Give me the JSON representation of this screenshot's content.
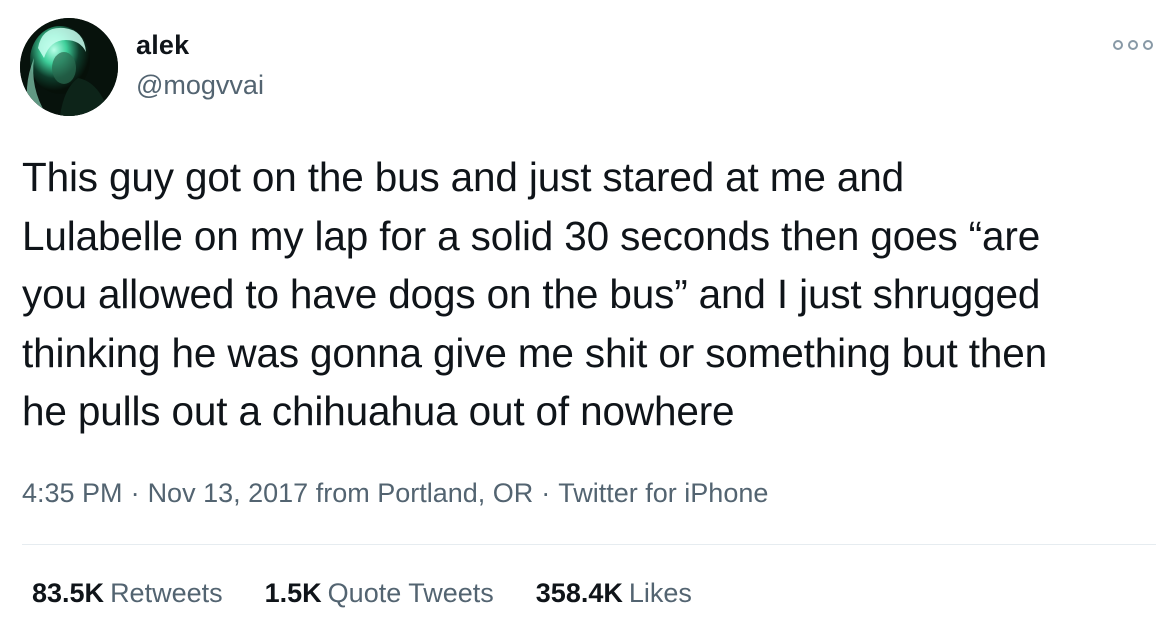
{
  "user": {
    "display_name": "alek",
    "handle": "@mogvvai"
  },
  "tweet": {
    "text": "This guy got on the bus and just stared at me and\nLulabelle on my lap for a solid 30 seconds then goes “are\nyou allowed to have dogs on the bus” and I just shrugged\nthinking he was gonna give me shit or something but then\nhe pulls out a chihuahua out of nowhere",
    "time": "4:35 PM",
    "date": "Nov 13, 2017",
    "location": "from Portland, OR",
    "separator": "·",
    "client": "Twitter for iPhone"
  },
  "stats": {
    "retweets_count": "83.5K",
    "retweets_label": "Retweets",
    "quotes_count": "1.5K",
    "quotes_label": "Quote Tweets",
    "likes_count": "358.4K",
    "likes_label": "Likes"
  },
  "icons": {
    "more": "more-options-icon"
  },
  "colors": {
    "primary_text": "#0f1419",
    "secondary_text": "#536471",
    "divider": "#e6ecf0"
  }
}
